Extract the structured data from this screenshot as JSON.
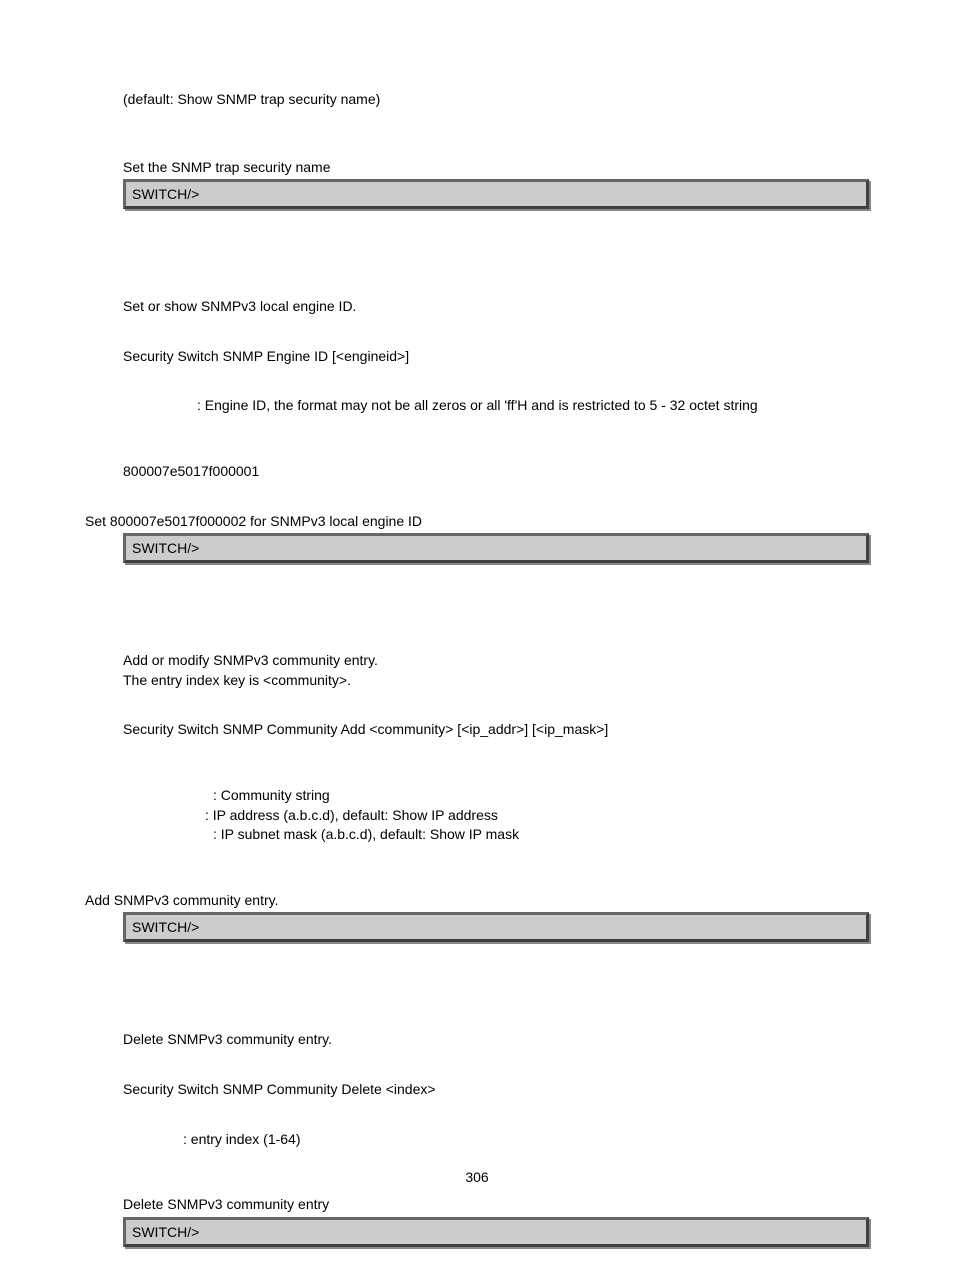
{
  "section1": {
    "default_line": "(default: Show SNMP trap security name)",
    "action_line": "Set the SNMP trap security name",
    "code": "SWITCH/>"
  },
  "section2": {
    "desc": "Set or show SNMPv3 local engine ID.",
    "syntax": "Security Switch SNMP Engine ID [<engineid>]",
    "param": ": Engine ID, the format may not be all zeros or all 'ff'H and is restricted to 5 - 32 octet string",
    "default": "800007e5017f000001",
    "action": "Set 800007e5017f000002 for SNMPv3 local engine ID",
    "code": "SWITCH/>"
  },
  "section3": {
    "desc1": "Add or modify SNMPv3 community entry.",
    "desc2": "The entry index key is <community>.",
    "syntax": "Security Switch SNMP Community Add <community> [<ip_addr>] [<ip_mask>]",
    "param1": ": Community string",
    "param2": ": IP address (a.b.c.d), default: Show IP address",
    "param3": ": IP subnet mask (a.b.c.d), default: Show IP mask",
    "action": "Add SNMPv3 community entry.",
    "code": "SWITCH/>"
  },
  "section4": {
    "desc": "Delete SNMPv3 community entry.",
    "syntax": "Security Switch SNMP Community Delete <index>",
    "param": ": entry index (1-64)",
    "action": "Delete SNMPv3 community entry",
    "code": "SWITCH/>"
  },
  "page_number": "306"
}
